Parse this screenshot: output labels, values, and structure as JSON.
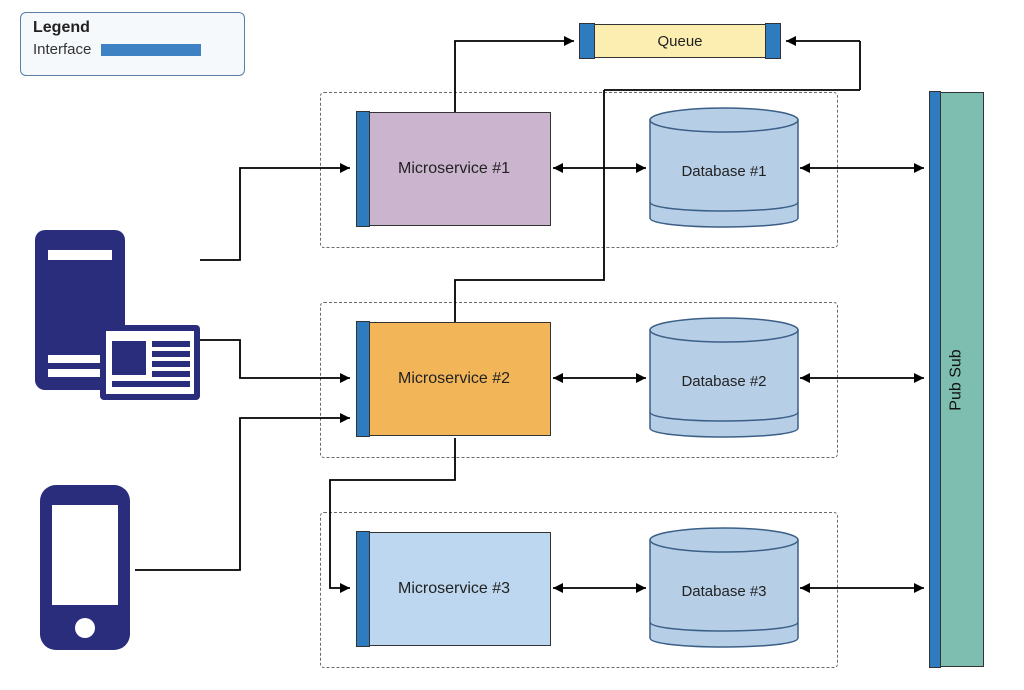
{
  "legend": {
    "title": "Legend",
    "interface": "Interface"
  },
  "queue": {
    "label": "Queue"
  },
  "microservices": [
    {
      "label": "Microservice #1"
    },
    {
      "label": "Microservice #2"
    },
    {
      "label": "Microservice #3"
    }
  ],
  "databases": [
    {
      "label": "Database #1"
    },
    {
      "label": "Database #2"
    },
    {
      "label": "Database #3"
    }
  ],
  "pubsub": {
    "label": "Pub Sub"
  },
  "colors": {
    "interface": "#2f7bbf",
    "ms1_fill": "#cbb4ce",
    "ms2_fill": "#f2b659",
    "ms3_fill": "#bcd7ef",
    "db_fill": "#b6cfe7",
    "queue_fill": "#fbeeb0",
    "pubsub_fill": "#7ebeb0",
    "client_icon": "#2a2c7c"
  }
}
